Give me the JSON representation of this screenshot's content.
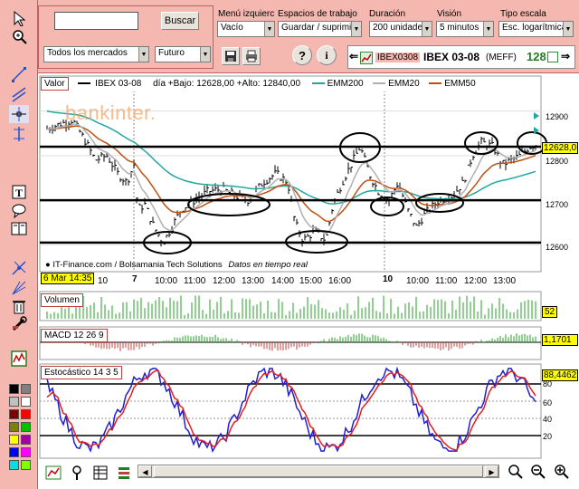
{
  "toolbar": {
    "search_value": "",
    "search_button": "Buscar",
    "markets_select": "Todos los mercados",
    "type_select": "Futuro",
    "menu_label": "Menú izquierc",
    "menu_value": "Vacío",
    "workspace_label": "Espacios de trabajo",
    "workspace_value": "Guardar / suprimir...",
    "duration_label": "Duración",
    "duration_value": "200 unidades",
    "view_label": "Visión",
    "view_value": "5 minutos",
    "scale_label": "Tipo escala",
    "scale_value": "Esc. logarítmica",
    "ticker_code": "IBEX0308",
    "ticker_name": "IBEX 03-08",
    "ticker_market": "(MEFF)",
    "ticker_value": "128"
  },
  "price_panel": {
    "header_label": "Valor",
    "series_name": "IBEX 03-08",
    "range_text": "día +Bajo: 12628,00 +Alto: 12840,00",
    "legend": [
      {
        "name": "EMM200",
        "color": "#20a8a0"
      },
      {
        "name": "EMM20",
        "color": "#b0b0b0"
      },
      {
        "name": "EMM50",
        "color": "#c05010"
      }
    ],
    "watermark": "bankinter.",
    "source_text": "IT-Finance.com / Bolsamania Tech Solutions",
    "realtime_text": "Datos en tiempo real",
    "last_value": "12628,0",
    "date_tag": "6 Mar 14:35",
    "y_ticks": [
      "12900",
      "12800",
      "12700",
      "12600"
    ]
  },
  "x_axis": {
    "labels": [
      "10",
      "7",
      "10:00",
      "11:00",
      "12:00",
      "13:00",
      "14:00",
      "15:00",
      "16:00",
      "10",
      "10:00",
      "11:00",
      "12:00",
      "13:00"
    ]
  },
  "volume_panel": {
    "label": "Volumen",
    "last_value": "52"
  },
  "macd_panel": {
    "label": "MACD 12 26 9",
    "last_value": "1,1701"
  },
  "stoch_panel": {
    "label": "Estocástico 14 3 5",
    "last_value": "88,4462",
    "y_ticks": [
      "80",
      "60",
      "40",
      "20"
    ]
  },
  "colors": {
    "accent": "#f4b8b0",
    "price_bar": "#000000",
    "ema200": "#20a8a0",
    "ema20": "#b0b0b0",
    "ema50": "#c05010",
    "stoch_k": "#2020d0",
    "stoch_d": "#e02020",
    "volume": "#20a020",
    "value_tag": "#ffff00"
  },
  "icons": {
    "left_tools": [
      "cursor-arrow-icon",
      "zoom-icon",
      "trendline-icon",
      "channel-icon",
      "crosshair-icon",
      "parallel-lines-icon",
      "text-icon",
      "comment-icon",
      "book-icon",
      "fibonacci-icon",
      "fan-icon",
      "trash-icon",
      "settings-icon",
      "indicator-icon"
    ]
  }
}
